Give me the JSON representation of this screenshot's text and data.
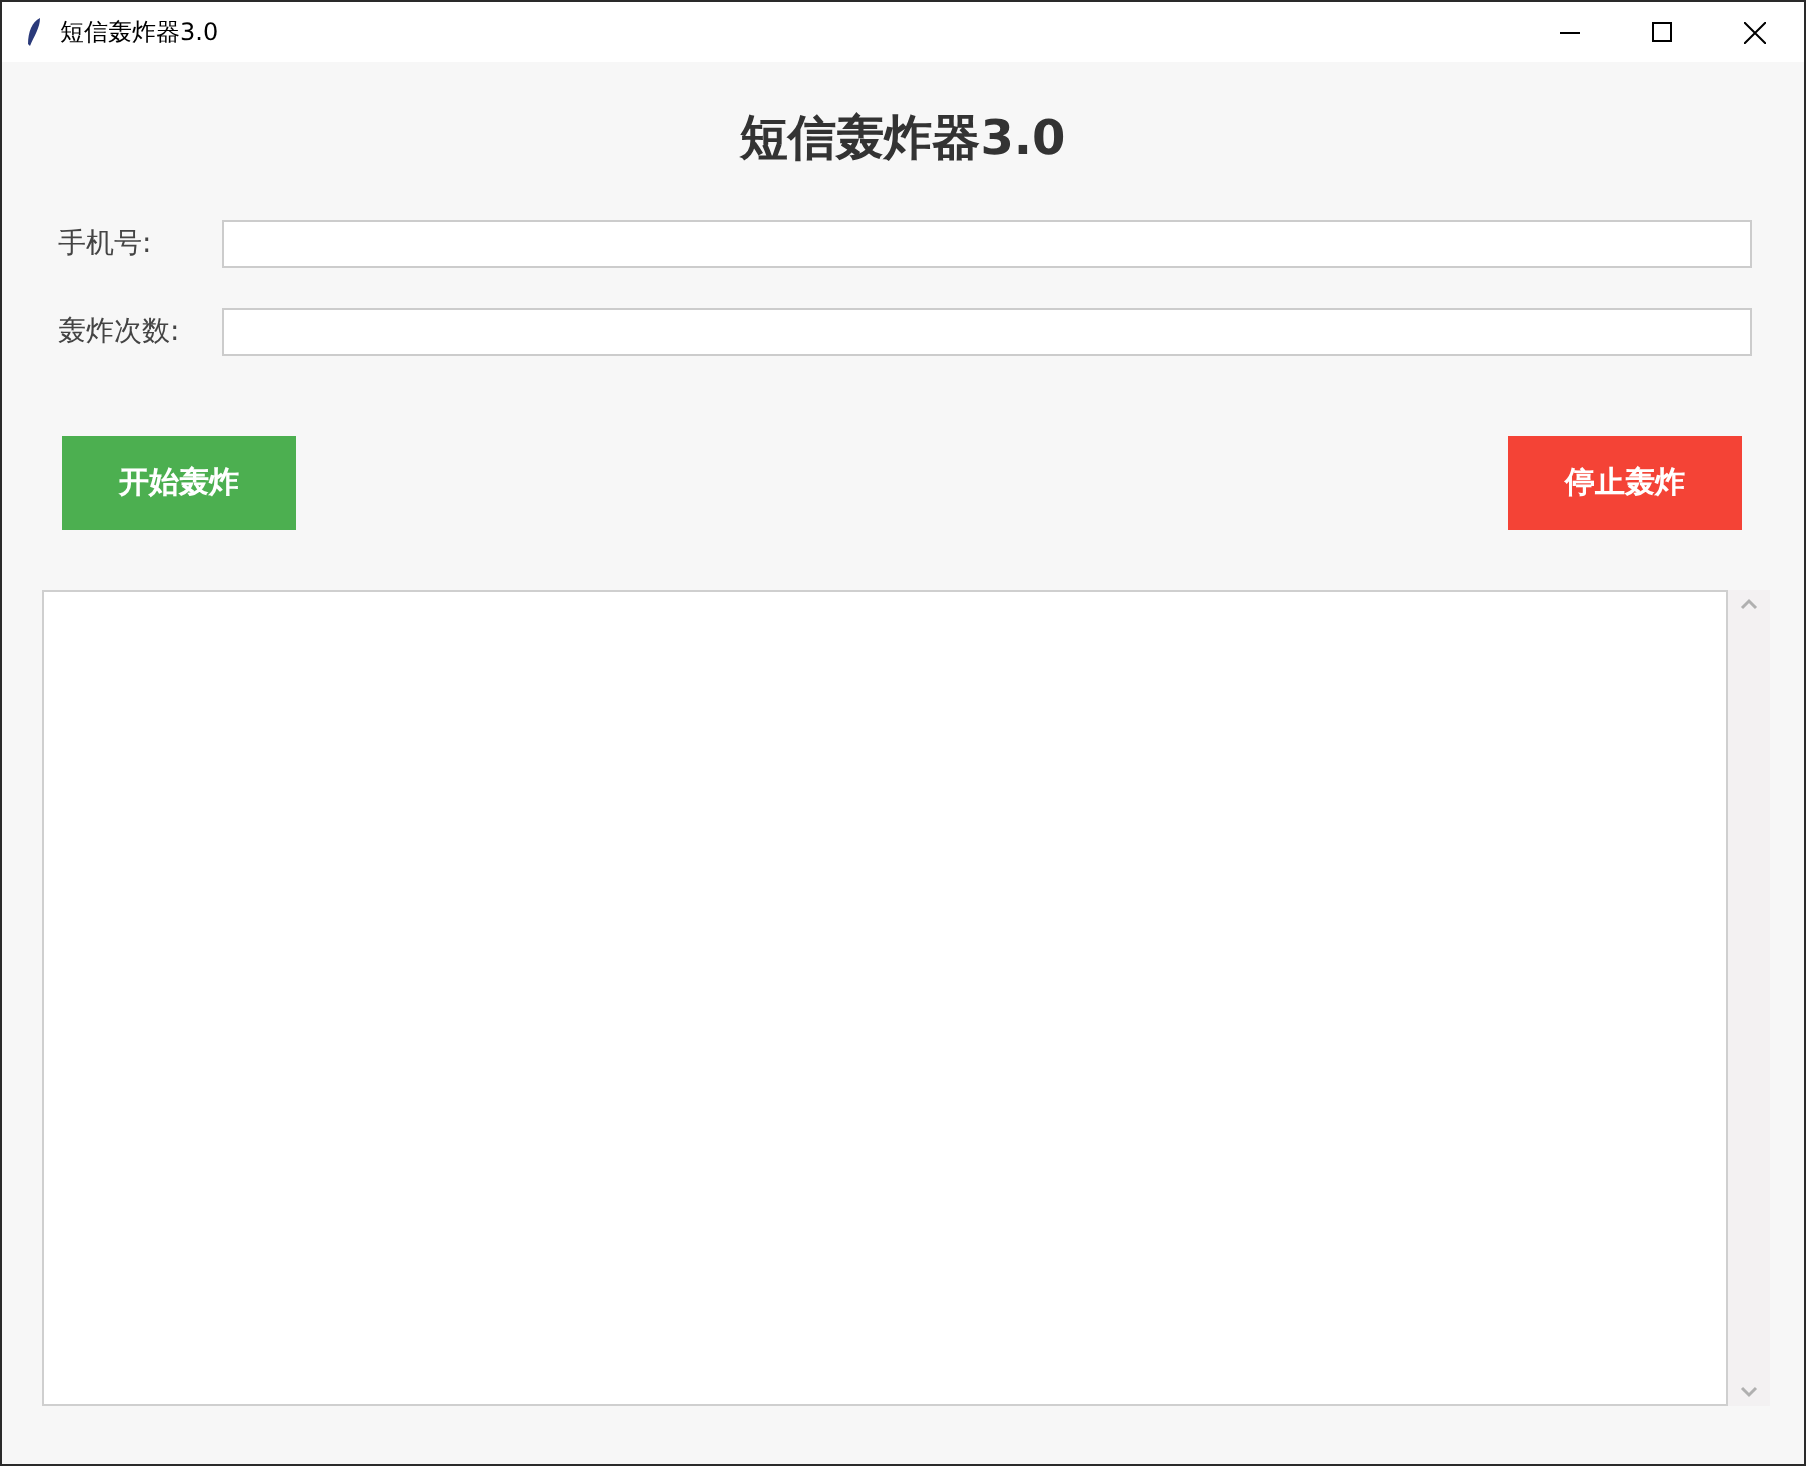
{
  "window": {
    "title": "短信轰炸器3.0"
  },
  "heading": "短信轰炸器3.0",
  "fields": [
    {
      "label": "手机号:"
    },
    {
      "label": "轰炸次数:"
    }
  ],
  "buttons": [
    {
      "label": "开始轰炸",
      "kind": "start"
    },
    {
      "label": "停止轰炸",
      "kind": "stop"
    }
  ]
}
